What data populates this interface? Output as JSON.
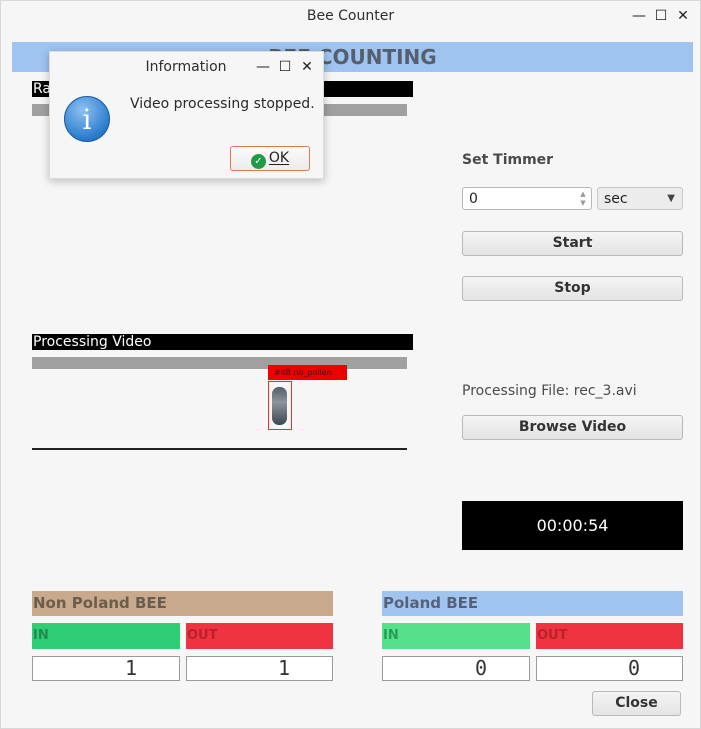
{
  "window": {
    "title": "Bee Counter",
    "minimize_glyph": "—",
    "maximize_glyph": "☐",
    "close_glyph": "✕"
  },
  "banner": {
    "text": "BEE COUNTING"
  },
  "raw_video": {
    "label": "Raw Video"
  },
  "processing_video": {
    "label": "Processing Video",
    "detection_tag": "#48  no_pollen"
  },
  "timer_settings": {
    "label": "Set Timmer",
    "value": "0",
    "unit": "sec",
    "unit_options": [
      "sec"
    ]
  },
  "buttons": {
    "start": "Start",
    "stop": "Stop",
    "browse": "Browse Video",
    "close": "Close"
  },
  "processing_file": {
    "label": "Processing File: rec_3.avi"
  },
  "elapsed": {
    "value": "00:00:54"
  },
  "non_poland_bee": {
    "title": "Non Poland BEE",
    "in_label": "IN",
    "out_label": "OUT",
    "in_count": "1",
    "out_count": "1",
    "colors": {
      "header": "#c8a98c",
      "in": "#2ecf74",
      "out": "#ef3340"
    }
  },
  "poland_bee": {
    "title": "Poland BEE",
    "in_label": "IN",
    "out_label": "OUT",
    "in_count": "0",
    "out_count": "0",
    "colors": {
      "header": "#9fc4f0",
      "in": "#55e08c",
      "out": "#ef3340"
    }
  },
  "dialog": {
    "title": "Information",
    "message": "Video processing stopped.",
    "ok_label": "OK",
    "icon": "info-icon"
  }
}
